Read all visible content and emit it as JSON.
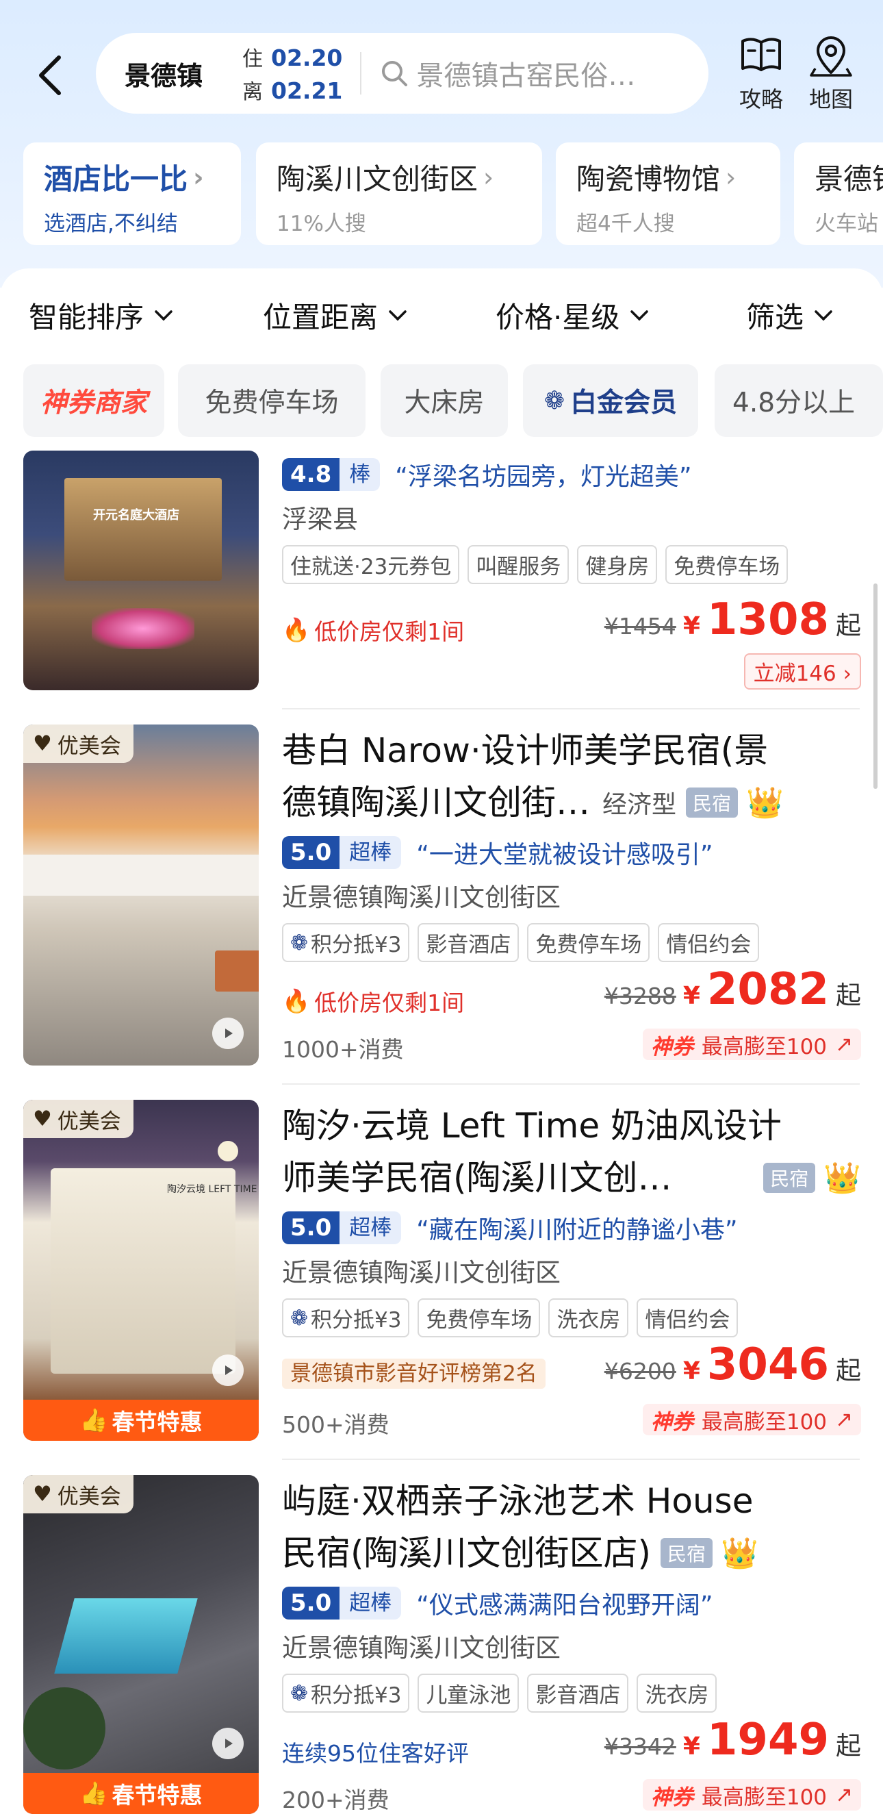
{
  "header": {
    "city": "景德镇",
    "checkin_label": "住",
    "checkin_date": "02.20",
    "checkout_label": "离",
    "checkout_date": "02.21",
    "search_placeholder": "景德镇古窑民俗…",
    "guide_label": "攻略",
    "map_label": "地图"
  },
  "chips": [
    {
      "title": "酒店比一比",
      "sub": "选酒店,不纠结"
    },
    {
      "title": "陶溪川文创街区",
      "sub": "11%人搜"
    },
    {
      "title": "陶瓷博物馆",
      "sub": "超4千人搜"
    },
    {
      "title": "景德镇",
      "sub": "火车站"
    }
  ],
  "sort": [
    "智能排序",
    "位置距离",
    "价格·星级",
    "筛选"
  ],
  "filters": [
    "神券商家",
    "免费停车场",
    "大床房",
    "白金会员",
    "4.8分以上"
  ],
  "hotels": [
    {
      "score": "4.8",
      "score_label": "棒",
      "quote": "“浮梁名坊园旁，灯光超美”",
      "location": "浮梁县",
      "tags": [
        "住就送·23元券包",
        "叫醒服务",
        "健身房",
        "免费停车场"
      ],
      "low_left": "低价房仅剩1间",
      "orig_price": "¥1454",
      "yen": "¥",
      "price": "1308",
      "qi": "起",
      "promo": "立减146 ›",
      "image_sign": "开元名庭大酒店"
    },
    {
      "badge": "优美会",
      "name": "巷白 Narow·设计师美学民宿(景",
      "name2": "德镇陶溪川文创街…",
      "level": "经济型",
      "minsu": "民宿",
      "score": "5.0",
      "score_label": "超棒",
      "quote": "“一进大堂就被设计感吸引”",
      "location": "近景德镇陶溪川文创街区",
      "tags": [
        "积分抵¥3",
        "影音酒店",
        "免费停车场",
        "情侣约会"
      ],
      "low_left": "低价房仅剩1间",
      "orig_price": "¥3288",
      "yen": "¥",
      "price": "2082",
      "qi": "起",
      "consume": "1000+消费",
      "shenquan": "神券",
      "promo": "最高膨至100"
    },
    {
      "badge": "优美会",
      "name": "陶汐·云境 Left Time 奶油风设计",
      "name2": "师美学民宿(陶溪川文创…",
      "minsu": "民宿",
      "score": "5.0",
      "score_label": "超棒",
      "quote": "“藏在陶溪川附近的静谧小巷”",
      "location": "近景德镇陶溪川文创街区",
      "tags": [
        "积分抵¥3",
        "免费停车场",
        "洗衣房",
        "情侣约会"
      ],
      "rank": "景德镇市影音好评榜第2名",
      "orig_price": "¥6200",
      "yen": "¥",
      "price": "3046",
      "qi": "起",
      "consume": "500+消费",
      "shenquan": "神券",
      "promo": "最高膨至100",
      "promo_bar": "春节特惠",
      "image_sign": "陶汐云境 LEFT TIME"
    },
    {
      "badge": "优美会",
      "name": "屿庭·双栖亲子泳池艺术 House",
      "name2": "民宿(陶溪川文创街区店)",
      "minsu": "民宿",
      "score": "5.0",
      "score_label": "超棒",
      "quote": "“仪式感满满阳台视野开阔”",
      "location": "近景德镇陶溪川文创街区",
      "tags": [
        "积分抵¥3",
        "儿童泳池",
        "影音酒店",
        "洗衣房"
      ],
      "streak": "连续95位住客好评",
      "orig_price": "¥3342",
      "yen": "¥",
      "price": "1949",
      "qi": "起",
      "consume": "200+消费",
      "shenquan": "神券",
      "promo": "最高膨至100",
      "promo_bar": "春节特惠"
    }
  ]
}
